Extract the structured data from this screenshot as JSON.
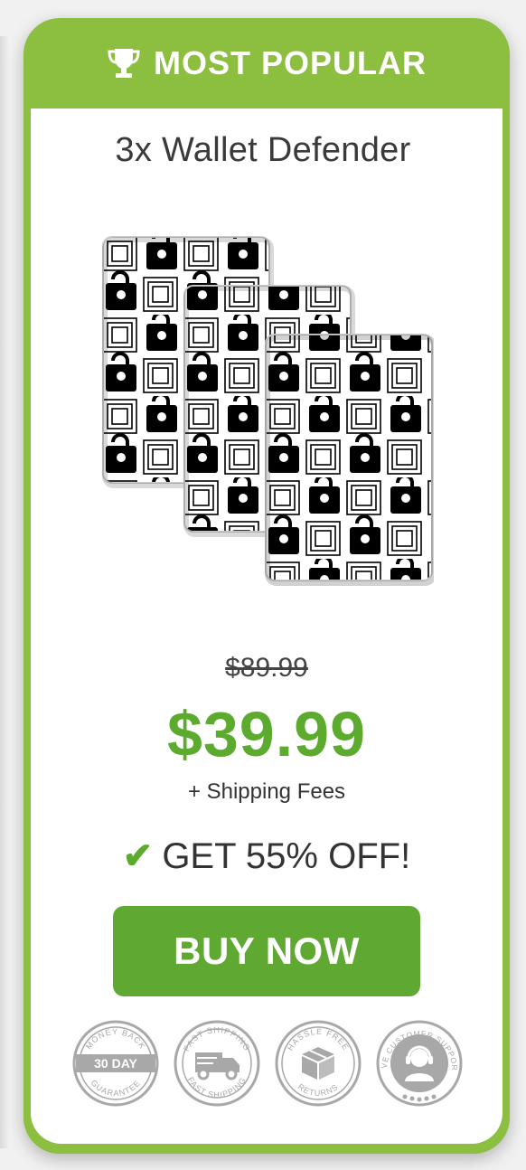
{
  "banner": {
    "label": "MOST POPULAR",
    "icon": "trophy-icon"
  },
  "product": {
    "title": "3x Wallet Defender",
    "image": "rfid-card-stack-image"
  },
  "pricing": {
    "old_price": "$89.99",
    "new_price": "$39.99",
    "shipping": "+ Shipping Fees",
    "discount": "GET 55% OFF!",
    "check_icon": "✔"
  },
  "cta": {
    "buy_label": "BUY NOW"
  },
  "badges": [
    {
      "name": "money-back-badge",
      "top_text": "MONEY BACK",
      "center_text": "30 DAY",
      "bottom_text": "GUARANTEE"
    },
    {
      "name": "fast-shipping-badge",
      "top_text": "FAST SHIPPING",
      "bottom_text": "FAST SHIPPING",
      "icon": "truck-icon"
    },
    {
      "name": "hassle-free-returns-badge",
      "top_text": "HASSLE FREE",
      "bottom_text": "RETURNS",
      "icon": "box-icon"
    },
    {
      "name": "live-support-badge",
      "top_text": "LIVE CUSTOMER SUPPORT",
      "icon": "headset-agent-icon"
    }
  ],
  "colors": {
    "brand_green": "#8cbe3f",
    "price_green": "#5cab2e",
    "button_green": "#5fa832",
    "badge_grey": "#a8a8a8"
  }
}
